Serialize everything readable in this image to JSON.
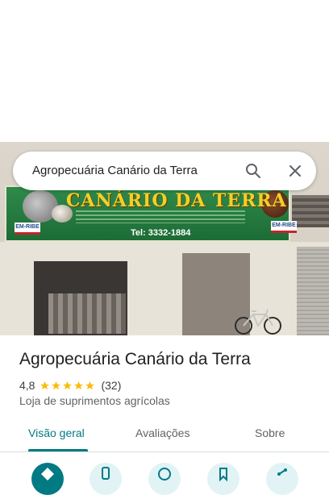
{
  "search": {
    "query": "Agropecuária Canário da Terra",
    "search_icon": "search-icon",
    "close_icon": "close-icon"
  },
  "photo": {
    "sign_title": "CANÁRIO DA TERRA",
    "sign_phone": "Tel: 3332-1884",
    "sign_logo_left": "EM-RIBE",
    "sign_logo_right": "EM-RIBE"
  },
  "place": {
    "name": "Agropecuária Canário da Terra",
    "rating": "4,8",
    "stars": 5,
    "review_count": "(32)",
    "category": "Loja de suprimentos agrícolas"
  },
  "tabs": [
    {
      "label": "Visão geral",
      "active": true
    },
    {
      "label": "Avaliações",
      "active": false
    },
    {
      "label": "Sobre",
      "active": false
    }
  ],
  "actions": [
    {
      "icon": "directions-icon"
    },
    {
      "icon": "phone-icon"
    },
    {
      "icon": "website-icon"
    },
    {
      "icon": "save-icon"
    },
    {
      "icon": "share-icon"
    }
  ],
  "colors": {
    "accent": "#017a84",
    "star": "#fbbc04"
  }
}
